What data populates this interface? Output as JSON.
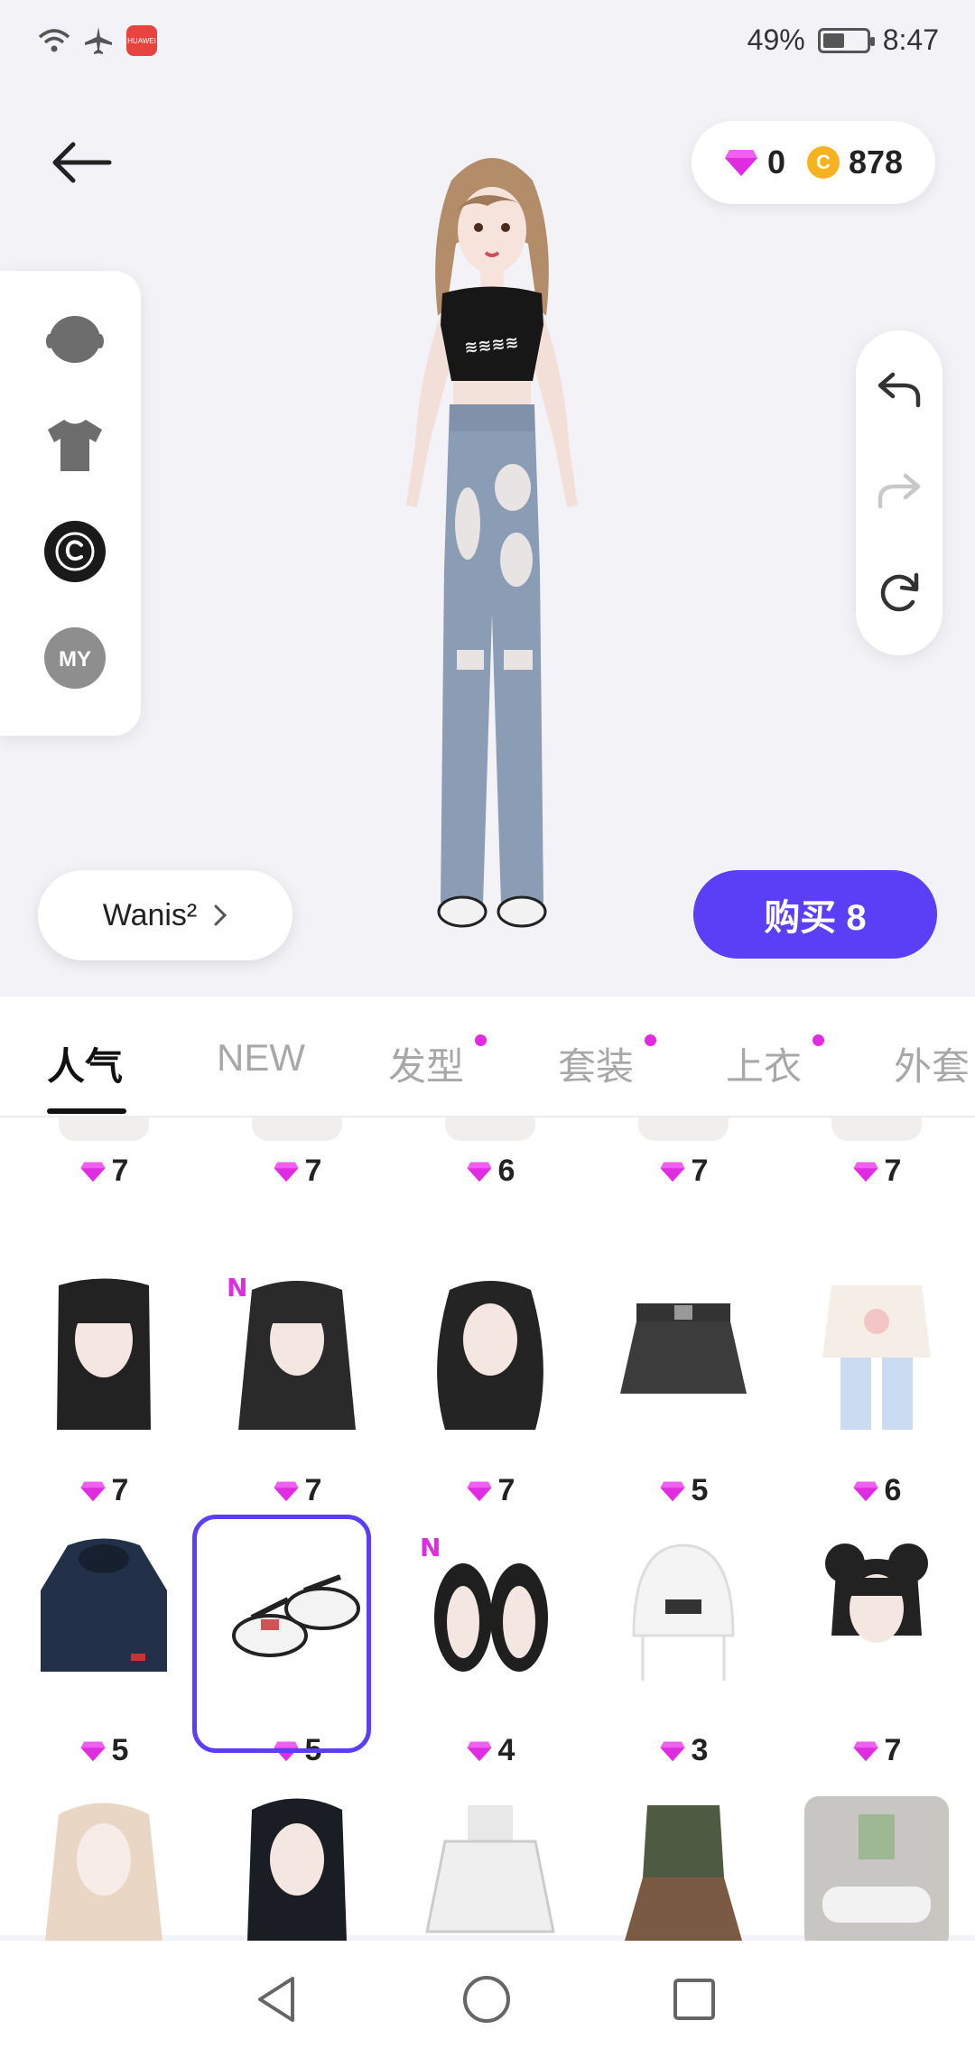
{
  "status": {
    "battery_percent": "49%",
    "battery_level": 0.49,
    "time": "8:47",
    "app_badge": "HUAWEI"
  },
  "currency": {
    "gems": "0",
    "coins": "878",
    "coin_symbol": "C"
  },
  "left_panel": {
    "items": [
      "head-icon",
      "shirt-icon",
      "copyright-icon",
      "my-icon"
    ],
    "my_label": "MY"
  },
  "right_panel": {
    "items": [
      "undo-icon",
      "redo-icon",
      "reset-icon"
    ]
  },
  "name_button": {
    "label": "Wanis²"
  },
  "buy_button": {
    "label": "购买 8"
  },
  "tabs": [
    {
      "label": "人气",
      "active": true,
      "dot": false
    },
    {
      "label": "NEW",
      "active": false,
      "dot": false
    },
    {
      "label": "发型",
      "active": false,
      "dot": true
    },
    {
      "label": "套装",
      "active": false,
      "dot": true
    },
    {
      "label": "上衣",
      "active": false,
      "dot": true
    },
    {
      "label": "外套",
      "active": false,
      "dot": false
    }
  ],
  "colors": {
    "accent": "#5a3ff6",
    "gem": "#e02ce0",
    "coin": "#f6b320"
  },
  "items": [
    {
      "row": 0,
      "price": "7",
      "kind": "partial"
    },
    {
      "row": 0,
      "price": "7",
      "kind": "partial"
    },
    {
      "row": 0,
      "price": "6",
      "kind": "partial"
    },
    {
      "row": 0,
      "price": "7",
      "kind": "partial"
    },
    {
      "row": 0,
      "price": "7",
      "kind": "partial"
    },
    {
      "row": 1,
      "price": "7",
      "kind": "hair-black-bangs"
    },
    {
      "row": 1,
      "price": "7",
      "kind": "hair-long",
      "new": true
    },
    {
      "row": 1,
      "price": "7",
      "kind": "hair-wavy"
    },
    {
      "row": 1,
      "price": "5",
      "kind": "skirt-black"
    },
    {
      "row": 1,
      "price": "6",
      "kind": "outfit-sweater"
    },
    {
      "row": 2,
      "price": "5",
      "kind": "hoodie-navy"
    },
    {
      "row": 2,
      "price": "5",
      "kind": "sneakers",
      "selected": true
    },
    {
      "row": 2,
      "price": "4",
      "kind": "sandals",
      "new": true
    },
    {
      "row": 2,
      "price": "3",
      "kind": "beanie-white"
    },
    {
      "row": 2,
      "price": "7",
      "kind": "hair-buns"
    },
    {
      "row": 3,
      "price": "",
      "kind": "hair-blonde"
    },
    {
      "row": 3,
      "price": "",
      "kind": "hair-black-straight"
    },
    {
      "row": 3,
      "price": "",
      "kind": "dress-white"
    },
    {
      "row": 3,
      "price": "",
      "kind": "outfit-olive"
    },
    {
      "row": 3,
      "price": "",
      "kind": "room-bathroom"
    }
  ],
  "new_badge": "N"
}
